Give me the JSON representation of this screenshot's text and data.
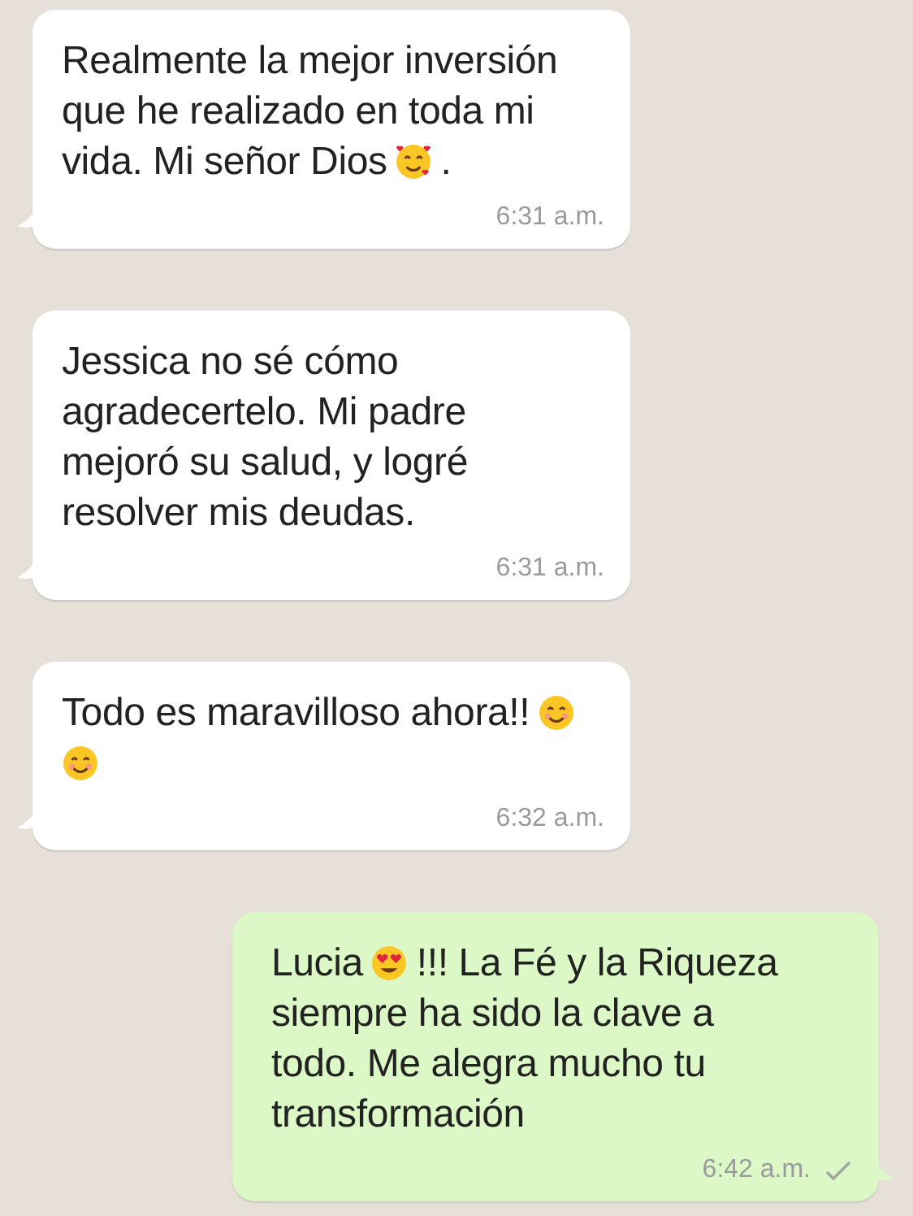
{
  "messages": [
    {
      "outgoing": false,
      "lines": [
        [
          {
            "kind": "text",
            "text": "Realmente la mejor inversión"
          }
        ],
        [
          {
            "kind": "text",
            "text": "que he realizado en toda mi"
          }
        ],
        [
          {
            "kind": "text",
            "text": "vida. Mi señor Dios"
          },
          {
            "kind": "emoji-hearts"
          },
          {
            "kind": "text",
            "text": "."
          }
        ]
      ],
      "time": "6:31 a.m."
    },
    {
      "outgoing": false,
      "lines": [
        [
          {
            "kind": "text",
            "text": "Jessica no sé cómo"
          }
        ],
        [
          {
            "kind": "text",
            "text": "agradecertelo. Mi padre"
          }
        ],
        [
          {
            "kind": "text",
            "text": "mejoró su salud, y logré"
          }
        ],
        [
          {
            "kind": "text",
            "text": "resolver mis deudas."
          }
        ]
      ],
      "time": "6:31 a.m."
    },
    {
      "outgoing": false,
      "lines": [
        [
          {
            "kind": "text",
            "text": "Todo es maravilloso ahora!!"
          },
          {
            "kind": "emoji-smile"
          }
        ],
        [
          {
            "kind": "emoji-smile"
          }
        ]
      ],
      "time": "6:32 a.m."
    },
    {
      "outgoing": true,
      "lines": [
        [
          {
            "kind": "text",
            "text": "Lucia"
          },
          {
            "kind": "emoji-heart-eyes"
          },
          {
            "kind": "text",
            "text": "!!! La Fé y la Riqueza"
          }
        ],
        [
          {
            "kind": "text",
            "text": "siempre ha sido la clave a"
          }
        ],
        [
          {
            "kind": "text",
            "text": "todo. Me alegra mucho tu"
          }
        ],
        [
          {
            "kind": "text",
            "text": "transformación"
          }
        ]
      ],
      "time": "6:42 a.m.",
      "delivered": false
    }
  ]
}
